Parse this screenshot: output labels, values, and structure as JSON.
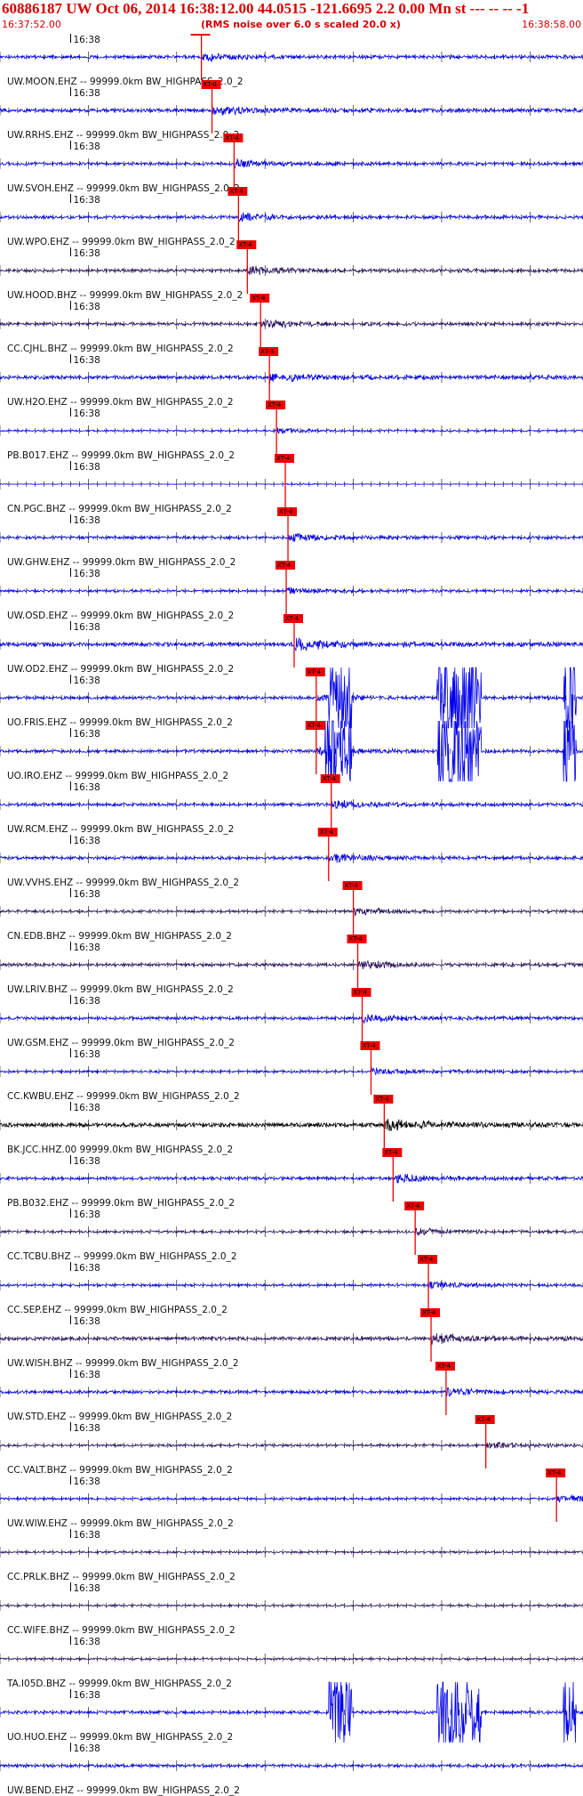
{
  "header": {
    "title": "60886187 UW Oct 06, 2014 16:38:12.00    44.0515 -121.6695  2.2 0.00 Mn st --- -- --  -1",
    "start_time": "16:37:52.00",
    "rms_note": "(RMS noise over 6.0 s scaled 20.0 x)",
    "end_time": "16:38:58.00"
  },
  "minute_mark": "16:38",
  "pick_label": "XT-4",
  "colors": {
    "title": "#d60000",
    "pick": "#ee0000",
    "trace_blue": "#0000ee",
    "trace_dark": "#2a1060",
    "trace_black": "#000000",
    "axis": "#000000"
  },
  "traces": [
    {
      "label": "UW.MOON.EHZ -- 99999.0km BW_HIGHPASS_2.0_2",
      "pick_s": 22.8,
      "color": "trace_blue",
      "amp": 0.5,
      "bursts": []
    },
    {
      "label": "UW.RRHS.EHZ -- 99999.0km BW_HIGHPASS_2.0_2",
      "pick_s": 24.0,
      "color": "trace_blue",
      "amp": 0.6,
      "bursts": []
    },
    {
      "label": "UW.SVOH.EHZ -- 99999.0km BW_HIGHPASS_2.0_2",
      "pick_s": 26.5,
      "color": "trace_blue",
      "amp": 0.5,
      "bursts": []
    },
    {
      "label": "UW.WPO.EHZ -- 99999.0km BW_HIGHPASS_2.0_2",
      "pick_s": 27.0,
      "color": "trace_blue",
      "amp": 0.5,
      "bursts": []
    },
    {
      "label": "UW.HOOD.BHZ -- 99999.0km BW_HIGHPASS_2.0_2",
      "pick_s": 28.0,
      "color": "trace_dark",
      "amp": 0.5,
      "bursts": []
    },
    {
      "label": "CC.CJHL.BHZ -- 99999.0km BW_HIGHPASS_2.0_2",
      "pick_s": 29.5,
      "color": "trace_dark",
      "amp": 0.5,
      "bursts": []
    },
    {
      "label": "UW.H2O.EHZ -- 99999.0km BW_HIGHPASS_2.0_2",
      "pick_s": 30.5,
      "color": "trace_blue",
      "amp": 0.6,
      "bursts": []
    },
    {
      "label": "PB.B017.EHZ -- 99999.0km BW_HIGHPASS_2.0_2",
      "pick_s": 31.3,
      "color": "trace_blue",
      "amp": 0.3,
      "bursts": []
    },
    {
      "label": "CN.PGC.BHZ -- 99999.0km BW_HIGHPASS_2.0_2",
      "pick_s": 32.3,
      "color": "trace_blue",
      "amp": 0.1,
      "bursts": []
    },
    {
      "label": "UW.GHW.EHZ -- 99999.0km BW_HIGHPASS_2.0_2",
      "pick_s": 32.6,
      "color": "trace_blue",
      "amp": 0.5,
      "bursts": []
    },
    {
      "label": "UW.OSD.EHZ -- 99999.0km BW_HIGHPASS_2.0_2",
      "pick_s": 32.4,
      "color": "trace_blue",
      "amp": 0.4,
      "bursts": []
    },
    {
      "label": "UW.OD2.EHZ -- 99999.0km BW_HIGHPASS_2.0_2",
      "pick_s": 33.3,
      "color": "trace_blue",
      "amp": 0.7,
      "bursts": []
    },
    {
      "label": "UO.FRIS.EHZ -- 99999.0km BW_HIGHPASS_2.0_2",
      "pick_s": 35.8,
      "color": "trace_blue",
      "amp": 0.5,
      "bursts": [
        [
          37.2,
          39.8
        ],
        [
          49.5,
          54.5
        ],
        [
          63.8,
          65.2
        ]
      ]
    },
    {
      "label": "UO.IRO.EHZ -- 99999.0km BW_HIGHPASS_2.0_2",
      "pick_s": 35.8,
      "color": "trace_blue",
      "amp": 0.5,
      "bursts": [
        [
          36.8,
          39.8
        ],
        [
          49.5,
          54.5
        ],
        [
          63.8,
          65.2
        ]
      ]
    },
    {
      "label": "UW.RCM.EHZ -- 99999.0km BW_HIGHPASS_2.0_2",
      "pick_s": 37.5,
      "color": "trace_blue",
      "amp": 0.5,
      "bursts": []
    },
    {
      "label": "UW.VVHS.EHZ -- 99999.0km BW_HIGHPASS_2.0_2",
      "pick_s": 37.2,
      "color": "trace_blue",
      "amp": 0.5,
      "bursts": []
    },
    {
      "label": "CN.EDB.BHZ -- 99999.0km BW_HIGHPASS_2.0_2",
      "pick_s": 40.0,
      "color": "trace_dark",
      "amp": 0.4,
      "bursts": []
    },
    {
      "label": "UW.LRIV.BHZ -- 99999.0km BW_HIGHPASS_2.0_2",
      "pick_s": 40.5,
      "color": "trace_dark",
      "amp": 0.5,
      "bursts": []
    },
    {
      "label": "UW.GSM.EHZ -- 99999.0km BW_HIGHPASS_2.0_2",
      "pick_s": 41.0,
      "color": "trace_blue",
      "amp": 0.5,
      "bursts": []
    },
    {
      "label": "CC.KWBU.EHZ -- 99999.0km BW_HIGHPASS_2.0_2",
      "pick_s": 42.0,
      "color": "trace_blue",
      "amp": 0.4,
      "bursts": []
    },
    {
      "label": "BK.JCC.HHZ.00 99999.0km BW_HIGHPASS_2.0_2",
      "pick_s": 43.5,
      "color": "trace_black",
      "amp": 0.7,
      "bursts": []
    },
    {
      "label": "PB.B032.EHZ -- 99999.0km BW_HIGHPASS_2.0_2",
      "pick_s": 44.5,
      "color": "trace_blue",
      "amp": 0.5,
      "bursts": []
    },
    {
      "label": "CC.TCBU.BHZ -- 99999.0km BW_HIGHPASS_2.0_2",
      "pick_s": 47.0,
      "color": "trace_dark",
      "amp": 0.4,
      "bursts": []
    },
    {
      "label": "CC.SEP.EHZ -- 99999.0km BW_HIGHPASS_2.0_2",
      "pick_s": 48.5,
      "color": "trace_blue",
      "amp": 0.4,
      "bursts": []
    },
    {
      "label": "UW.WISH.BHZ -- 99999.0km BW_HIGHPASS_2.0_2",
      "pick_s": 48.8,
      "color": "trace_dark",
      "amp": 0.6,
      "bursts": []
    },
    {
      "label": "UW.STD.EHZ -- 99999.0km BW_HIGHPASS_2.0_2",
      "pick_s": 50.5,
      "color": "trace_blue",
      "amp": 0.5,
      "bursts": []
    },
    {
      "label": "CC.VALT.BHZ -- 99999.0km BW_HIGHPASS_2.0_2",
      "pick_s": 55.0,
      "color": "trace_dark",
      "amp": 0.4,
      "bursts": []
    },
    {
      "label": "UW.WIW.EHZ -- 99999.0km BW_HIGHPASS_2.0_2",
      "pick_s": 63.0,
      "color": "trace_blue",
      "amp": 0.4,
      "bursts": []
    },
    {
      "label": "CC.PRLK.BHZ -- 99999.0km BW_HIGHPASS_2.0_2",
      "pick_s": null,
      "color": "trace_dark",
      "amp": 0.35,
      "bursts": []
    },
    {
      "label": "CC.WIFE.BHZ -- 99999.0km BW_HIGHPASS_2.0_2",
      "pick_s": null,
      "color": "trace_dark",
      "amp": 0.35,
      "bursts": []
    },
    {
      "label": "TA.I05D.BHZ -- 99999.0km BW_HIGHPASS_2.0_2",
      "pick_s": null,
      "color": "trace_dark",
      "amp": 0.35,
      "bursts": []
    },
    {
      "label": "UO.HUO.EHZ -- 99999.0km BW_HIGHPASS_2.0_2",
      "pick_s": null,
      "color": "trace_blue",
      "amp": 0.5,
      "bursts": [
        [
          37.2,
          39.8
        ],
        [
          49.5,
          54.5
        ],
        [
          63.8,
          65.2
        ]
      ]
    },
    {
      "label": "UW.BEND.EHZ -- 99999.0km BW_HIGHPASS_2.0_2",
      "pick_s": null,
      "color": "trace_blue",
      "amp": 0.5,
      "bursts": []
    }
  ]
}
